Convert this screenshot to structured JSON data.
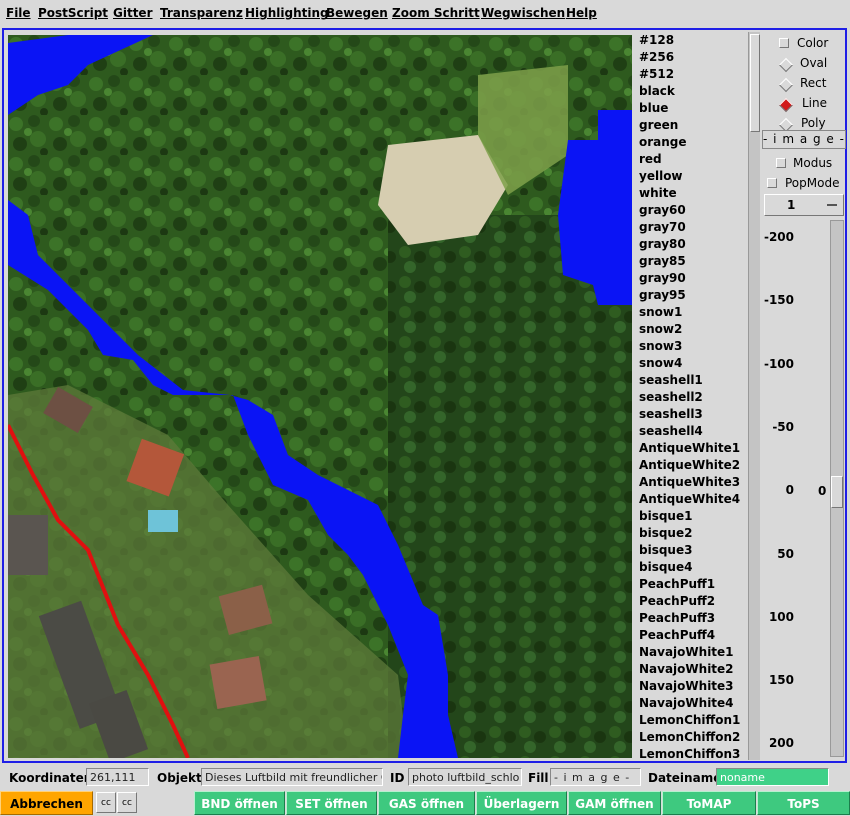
{
  "menu": [
    "File",
    "PostScript",
    "Gitter",
    "Transparenz",
    "Highlighting",
    "Bewegen",
    "Zoom Schritt",
    "Wegwischen",
    "Help"
  ],
  "colors": [
    "#128",
    "#256",
    "#512",
    "black",
    "blue",
    "green",
    "orange",
    "red",
    "yellow",
    "white",
    "gray60",
    "gray70",
    "gray80",
    "gray85",
    "gray90",
    "gray95",
    "snow1",
    "snow2",
    "snow3",
    "snow4",
    "seashell1",
    "seashell2",
    "seashell3",
    "seashell4",
    "AntiqueWhite1",
    "AntiqueWhite2",
    "AntiqueWhite3",
    "AntiqueWhite4",
    "bisque1",
    "bisque2",
    "bisque3",
    "bisque4",
    "PeachPuff1",
    "PeachPuff2",
    "PeachPuff3",
    "PeachPuff4",
    "NavajoWhite1",
    "NavajoWhite2",
    "NavajoWhite3",
    "NavajoWhite4",
    "LemonChiffon1",
    "LemonChiffon2",
    "LemonChiffon3"
  ],
  "tools": {
    "color": "Color",
    "oval": "Oval",
    "rect": "Rect",
    "line": "Line",
    "poly": "Poly",
    "selected": "Line",
    "image_label": "- i m a g e -",
    "modus": "Modus",
    "popmode": "PopMode",
    "spin_value": "1",
    "scale": [
      "-200",
      "-150",
      "-100",
      "-50",
      "0",
      "50",
      "100",
      "150",
      "200"
    ],
    "scale_value": "0"
  },
  "status": {
    "koordinaten_label": "Koordinaten",
    "koordinaten": "261,111",
    "objekt_label": "Objekt",
    "objekt": "Dieses Luftbild mit freundlicher G",
    "id_label": "ID",
    "id": "photo luftbild_schlo",
    "fill_label": "Fill",
    "fill": "- i m a g e -",
    "dateiname_label": "Dateiname",
    "dateiname": "noname"
  },
  "buttons": {
    "abbrechen": "Abbrechen",
    "cc1": "cc",
    "cc2": "cc",
    "bnd": "BND öffnen",
    "set": "SET öffnen",
    "gas": "GAS öffnen",
    "ueberlagern": "Überlagern",
    "gam": "GAM öffnen",
    "tomap": "ToMAP",
    "tops": "ToPS"
  },
  "canvas_colors": {
    "forest": "#2f5a1e",
    "overlay_blue": "#0a14f5",
    "line_red": "#e01010",
    "frame_blue": "#1f1fe6"
  }
}
